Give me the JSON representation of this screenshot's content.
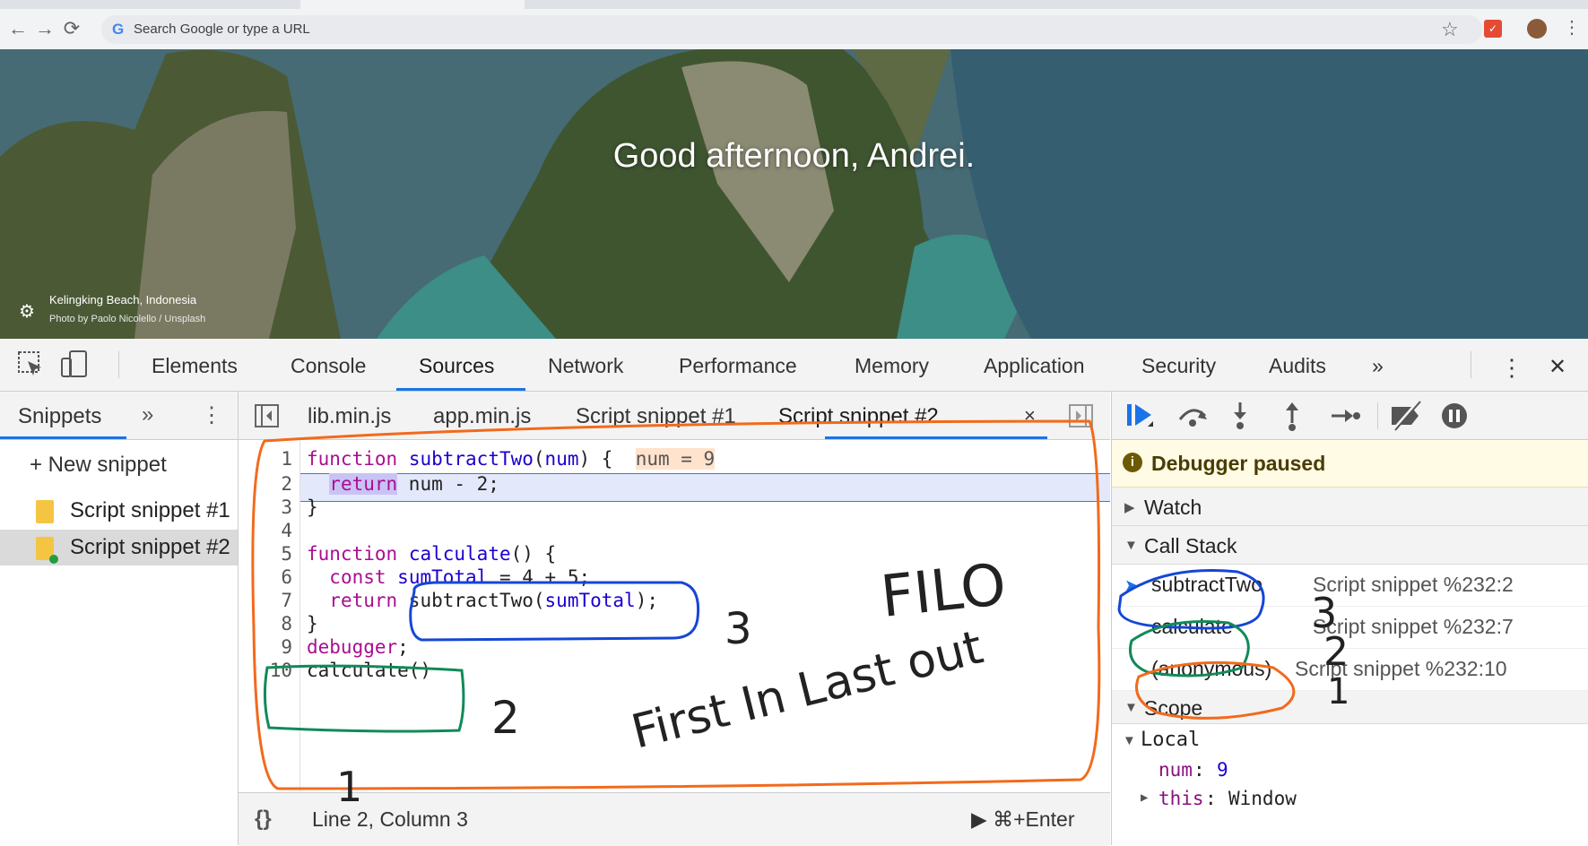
{
  "browser": {
    "omnibox_placeholder": "Search Google or type a URL",
    "back_icon": "←",
    "forward_icon": "→",
    "reload_icon": "⟳",
    "star_icon": "☆",
    "menu_icon": "⋮"
  },
  "newtab": {
    "greeting": "Good afternoon, Andrei.",
    "photo_location": "Kelingking Beach, Indonesia",
    "photo_credit": "Photo by Paolo Nicolello / Unsplash"
  },
  "devtools": {
    "tabs": [
      "Elements",
      "Console",
      "Sources",
      "Network",
      "Performance",
      "Memory",
      "Application",
      "Security",
      "Audits"
    ],
    "active_tab": "Sources",
    "more_tabs": "»",
    "close": "✕",
    "navigator": {
      "tab_label": "Snippets",
      "more": "»",
      "new_snippet": "+ New snippet",
      "items": [
        "Script snippet #1",
        "Script snippet #2"
      ]
    },
    "editor": {
      "tabs": [
        "lib.min.js",
        "app.min.js",
        "Script snippet #1",
        "Script snippet #2"
      ],
      "active_tab": "Script snippet #2",
      "tab_close": "×",
      "inline_value": "num = 9",
      "status_position": "Line 2, Column 3",
      "run_hint": "▶ ⌘+Enter",
      "format_icon": "{}"
    },
    "debugger": {
      "paused_message": "Debugger paused",
      "watch_label": "Watch",
      "call_stack_label": "Call Stack",
      "call_stack": [
        {
          "fn": "subtractTwo",
          "loc": "Script snippet %232:2"
        },
        {
          "fn": "calculate",
          "loc": "Script snippet %232:7"
        },
        {
          "fn": "(anonymous)",
          "loc": "Script snippet %232:10"
        }
      ],
      "scope_label": "Scope",
      "local_label": "Local",
      "scope_vars": [
        {
          "name": "num",
          "value": "9"
        },
        {
          "name": "this",
          "value": "Window"
        }
      ]
    }
  },
  "annotations": {
    "title": "FILO",
    "subtitle": "First In Last out",
    "numbers": [
      "3",
      "2",
      "1"
    ]
  },
  "colors": {
    "accent": "#1a73e8",
    "annot_orange": "#f26a1b",
    "annot_blue": "#1546d6",
    "annot_green": "#118a5a",
    "keyword": "#aa0d91",
    "paused_bg": "#fffbe5"
  }
}
